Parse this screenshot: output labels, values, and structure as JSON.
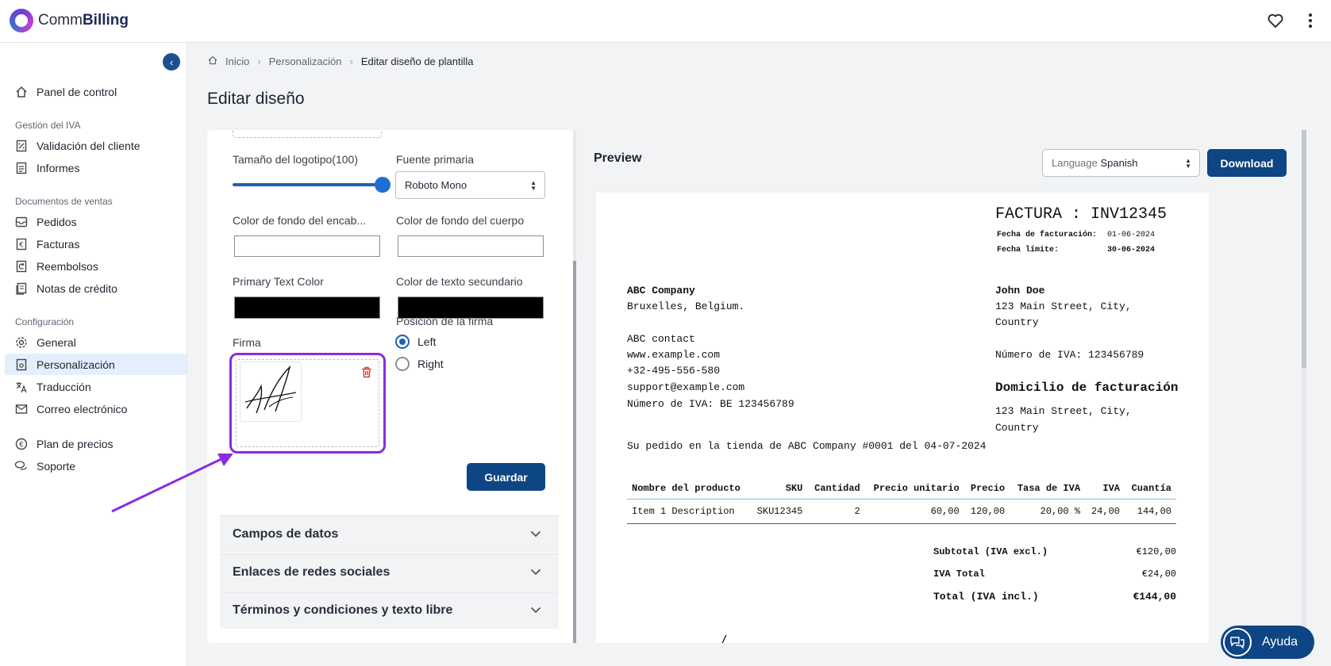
{
  "app": {
    "brand_part1": "Comm",
    "brand_part2": "Billing"
  },
  "sidebar": {
    "dashboard": "Panel de control",
    "section_vat": "Gestión del IVA",
    "customer_validation": "Validación del cliente",
    "reports": "Informes",
    "section_sales": "Documentos de ventas",
    "orders": "Pedidos",
    "invoices": "Facturas",
    "refunds": "Reembolsos",
    "credit_notes": "Notas de crédito",
    "section_config": "Configuración",
    "general": "General",
    "customization": "Personalización",
    "translation": "Traducción",
    "email": "Correo electrónico",
    "pricing_plan": "Plan de precios",
    "support": "Soporte"
  },
  "breadcrumb": {
    "home": "Inicio",
    "customization": "Personalización",
    "current": "Editar diseño de plantilla"
  },
  "page_title": "Editar diseño",
  "editor": {
    "logo_size_label": "Tamaño del logotipo(100)",
    "logo_size_value": 100,
    "primary_font_label": "Fuente primaria",
    "primary_font_value": "Roboto Mono",
    "header_bg_label": "Color de fondo del encab...",
    "body_bg_label": "Color de fondo del cuerpo",
    "header_bg_color": "#ffffff",
    "body_bg_color": "#ffffff",
    "primary_text_label": "Primary Text Color",
    "secondary_text_label": "Color de texto secundario",
    "primary_text_color": "#000000",
    "secondary_text_color": "#000000",
    "signature_label": "Firma",
    "signature_position_label": "Posición de la firma",
    "position_left": "Left",
    "position_right": "Right",
    "position_selected": "Left",
    "save_button": "Guardar",
    "accordion_fields": "Campos de datos",
    "accordion_social": "Enlaces de redes sociales",
    "accordion_terms": "Términos y condiciones y texto libre"
  },
  "preview": {
    "title": "Preview",
    "language_label": "Language",
    "language_value": "Spanish",
    "download_button": "Download",
    "invoice": {
      "heading": "FACTURA : INV12345",
      "invoice_date_label": "Fecha de facturación:",
      "invoice_date": "01-06-2024",
      "due_date_label": "Fecha límite:",
      "due_date": "30-06-2024",
      "seller_name": "ABC Company",
      "seller_address": "Bruxelles, Belgium.",
      "seller_contact": "ABC contact",
      "seller_web": "www.example.com",
      "seller_phone": "+32-495-556-580",
      "seller_email": "support@example.com",
      "seller_vat": "Número de IVA: BE 123456789",
      "buyer_name": "John Doe",
      "buyer_address_1": "123 Main Street, City,",
      "buyer_address_2": "Country",
      "buyer_vat": "Número de IVA: 123456789",
      "billing_heading": "Domicilio de facturación",
      "billing_address_1": "123 Main Street, City,",
      "billing_address_2": "Country",
      "order_line": "Su pedido en la tienda de ABC Company #0001 del 04-07-2024",
      "table": {
        "headers": [
          "Nombre del producto",
          "SKU",
          "Cantidad",
          "Precio unitario",
          "Precio",
          "Tasa de IVA",
          "IVA",
          "Cuantía"
        ],
        "rows": [
          [
            "Item 1 Description",
            "SKU12345",
            "2",
            "60,00",
            "120,00",
            "20,00 %",
            "24,00",
            "144,00"
          ]
        ]
      },
      "subtotal_label": "Subtotal (IVA excl.)",
      "subtotal_value": "€120,00",
      "vat_total_label": "IVA Total",
      "vat_total_value": "€24,00",
      "total_label": "Total (IVA incl.)",
      "total_value": "€144,00"
    }
  },
  "help_button": "Ayuda",
  "colors": {
    "accent": "#0e4585",
    "highlight": "#8a2be2",
    "delete": "#d23b3b"
  }
}
